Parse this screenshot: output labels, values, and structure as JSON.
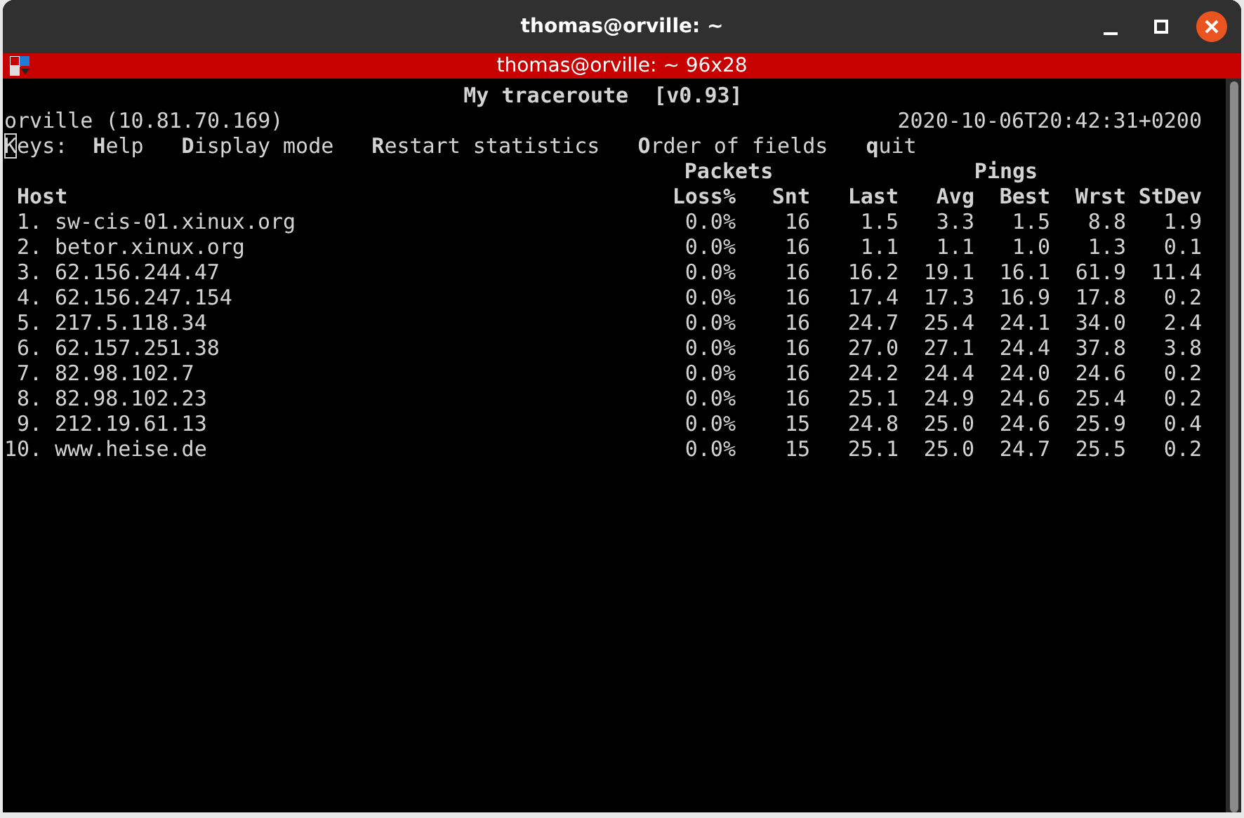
{
  "window": {
    "title": "thomas@orville: ~"
  },
  "tab_bar": {
    "title": "thomas@orville: ~ 96x28"
  },
  "terminal": {
    "heading": "My traceroute  [v0.93]",
    "host_line": "orville (10.81.70.169)",
    "timestamp": "2020-10-06T20:42:31+0200",
    "keys_label": "Keys:",
    "cursor_on_label": true,
    "keys": [
      "**H**elp",
      "**D**isplay mode",
      "**R**estart statistics",
      "**O**rder of fields",
      "**q**uit"
    ],
    "groups": [
      {
        "label": "Packets"
      },
      {
        "label": "Pings"
      }
    ],
    "columns": [
      "Host",
      "Loss%",
      "Snt",
      "Last",
      "Avg",
      "Best",
      "Wrst",
      "StDev"
    ],
    "rows": [
      {
        "number": "1.",
        "host": "sw-cis-01.xinux.org",
        "values": [
          "0.0%",
          "16",
          "1.5",
          "3.3",
          "1.5",
          "8.8",
          "1.9"
        ]
      },
      {
        "number": "2.",
        "host": "betor.xinux.org",
        "values": [
          "0.0%",
          "16",
          "1.1",
          "1.1",
          "1.0",
          "1.3",
          "0.1"
        ]
      },
      {
        "number": "3.",
        "host": "62.156.244.47",
        "values": [
          "0.0%",
          "16",
          "16.2",
          "19.1",
          "16.1",
          "61.9",
          "11.4"
        ]
      },
      {
        "number": "4.",
        "host": "62.156.247.154",
        "values": [
          "0.0%",
          "16",
          "17.4",
          "17.3",
          "16.9",
          "17.8",
          "0.2"
        ]
      },
      {
        "number": "5.",
        "host": "217.5.118.34",
        "values": [
          "0.0%",
          "16",
          "24.7",
          "25.4",
          "24.1",
          "34.0",
          "2.4"
        ]
      },
      {
        "number": "6.",
        "host": "62.157.251.38",
        "values": [
          "0.0%",
          "16",
          "27.0",
          "27.1",
          "24.4",
          "37.8",
          "3.8"
        ]
      },
      {
        "number": "7.",
        "host": "82.98.102.7",
        "values": [
          "0.0%",
          "16",
          "24.2",
          "24.4",
          "24.0",
          "24.6",
          "0.2"
        ]
      },
      {
        "number": "8.",
        "host": "82.98.102.23",
        "values": [
          "0.0%",
          "16",
          "25.1",
          "24.9",
          "24.6",
          "25.4",
          "0.2"
        ]
      },
      {
        "number": "9.",
        "host": "212.19.61.13",
        "values": [
          "0.0%",
          "15",
          "24.8",
          "25.0",
          "24.6",
          "25.9",
          "0.4"
        ]
      },
      {
        "number": "10.",
        "host": "www.heise.de",
        "values": [
          "0.0%",
          "15",
          "25.1",
          "25.0",
          "24.7",
          "25.5",
          "0.2"
        ]
      }
    ]
  }
}
